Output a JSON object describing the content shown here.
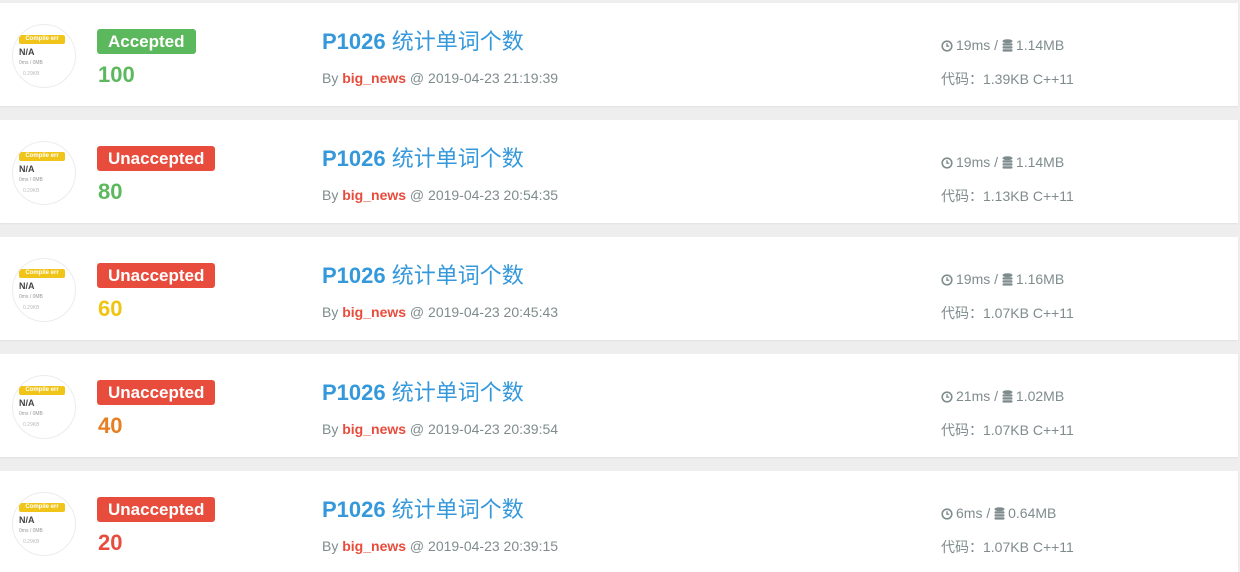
{
  "avatar": {
    "badge": "Compile err",
    "na": "N/A",
    "stats": "0ms / 0MB",
    "code": "0.29KB",
    "colors": {
      "badge": "#f0c419"
    }
  },
  "labels": {
    "by": "By",
    "at": "@",
    "slash": "/",
    "code_prefix": "代码："
  },
  "colors": {
    "accepted": "#5cb85c",
    "unaccepted": "#e74c3c",
    "problem_link": "#3498db",
    "user_link": "#e74c3c",
    "meta_text": "#7f8c8d"
  },
  "records": [
    {
      "status": "Accepted",
      "status_color": "#5cb85c",
      "score": "100",
      "score_color": "#5cb85c",
      "pid": "P1026",
      "title": "统计单词个数",
      "user": "big_news",
      "time": "2019-04-23 21:19:39",
      "duration": "19ms",
      "memory": "1.14MB",
      "code_size": "1.39KB",
      "lang": "C++11",
      "icons": [
        "clock-icon",
        "database-icon"
      ]
    },
    {
      "status": "Unaccepted",
      "status_color": "#e74c3c",
      "score": "80",
      "score_color": "#5cb85c",
      "pid": "P1026",
      "title": "统计单词个数",
      "user": "big_news",
      "time": "2019-04-23 20:54:35",
      "duration": "19ms",
      "memory": "1.14MB",
      "code_size": "1.13KB",
      "lang": "C++11",
      "icons": [
        "clock-icon",
        "database-icon"
      ]
    },
    {
      "status": "Unaccepted",
      "status_color": "#e74c3c",
      "score": "60",
      "score_color": "#f1c40f",
      "pid": "P1026",
      "title": "统计单词个数",
      "user": "big_news",
      "time": "2019-04-23 20:45:43",
      "duration": "19ms",
      "memory": "1.16MB",
      "code_size": "1.07KB",
      "lang": "C++11",
      "icons": [
        "clock-icon",
        "database-icon"
      ]
    },
    {
      "status": "Unaccepted",
      "status_color": "#e74c3c",
      "score": "40",
      "score_color": "#e67e22",
      "pid": "P1026",
      "title": "统计单词个数",
      "user": "big_news",
      "time": "2019-04-23 20:39:54",
      "duration": "21ms",
      "memory": "1.02MB",
      "code_size": "1.07KB",
      "lang": "C++11",
      "icons": [
        "clock-icon",
        "database-icon"
      ]
    },
    {
      "status": "Unaccepted",
      "status_color": "#e74c3c",
      "score": "20",
      "score_color": "#e74c3c",
      "pid": "P1026",
      "title": "统计单词个数",
      "user": "big_news",
      "time": "2019-04-23 20:39:15",
      "duration": "6ms",
      "memory": "0.64MB",
      "code_size": "1.07KB",
      "lang": "C++11",
      "icons": [
        "clock-icon",
        "database-icon"
      ]
    }
  ]
}
